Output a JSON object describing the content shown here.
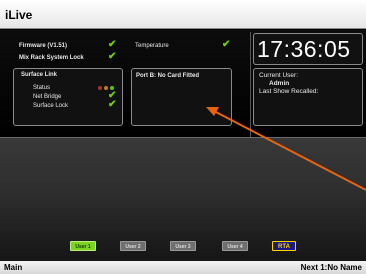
{
  "titlebar": {
    "title": "iLive"
  },
  "system": {
    "firmware": "Firmware (V1.51)",
    "temperature": "Temperature",
    "mixrack_lock": "Mix Rack System Lock",
    "surface_link": {
      "title": "Surface Link",
      "status": "Status",
      "net_bridge": "Net Bridge",
      "surface_lock": "Surface Lock"
    },
    "port_b": "Port B: No Card Fitted"
  },
  "clock": "17:36:05",
  "user": {
    "current_user_label": "Current User:",
    "name": "Admin",
    "last_show_label": "Last Show Recalled:"
  },
  "tabs": [
    "User 1",
    "User 2",
    "User 3",
    "User 4",
    "RTA"
  ],
  "statusbar": {
    "left": "Main",
    "right": "Next 1:No Name"
  },
  "colors": {
    "ok_tick": "#70d000",
    "annotation_arrow": "#e8640c",
    "active_tab": "#7ed321"
  },
  "icons": {
    "ok": "check-icon"
  }
}
